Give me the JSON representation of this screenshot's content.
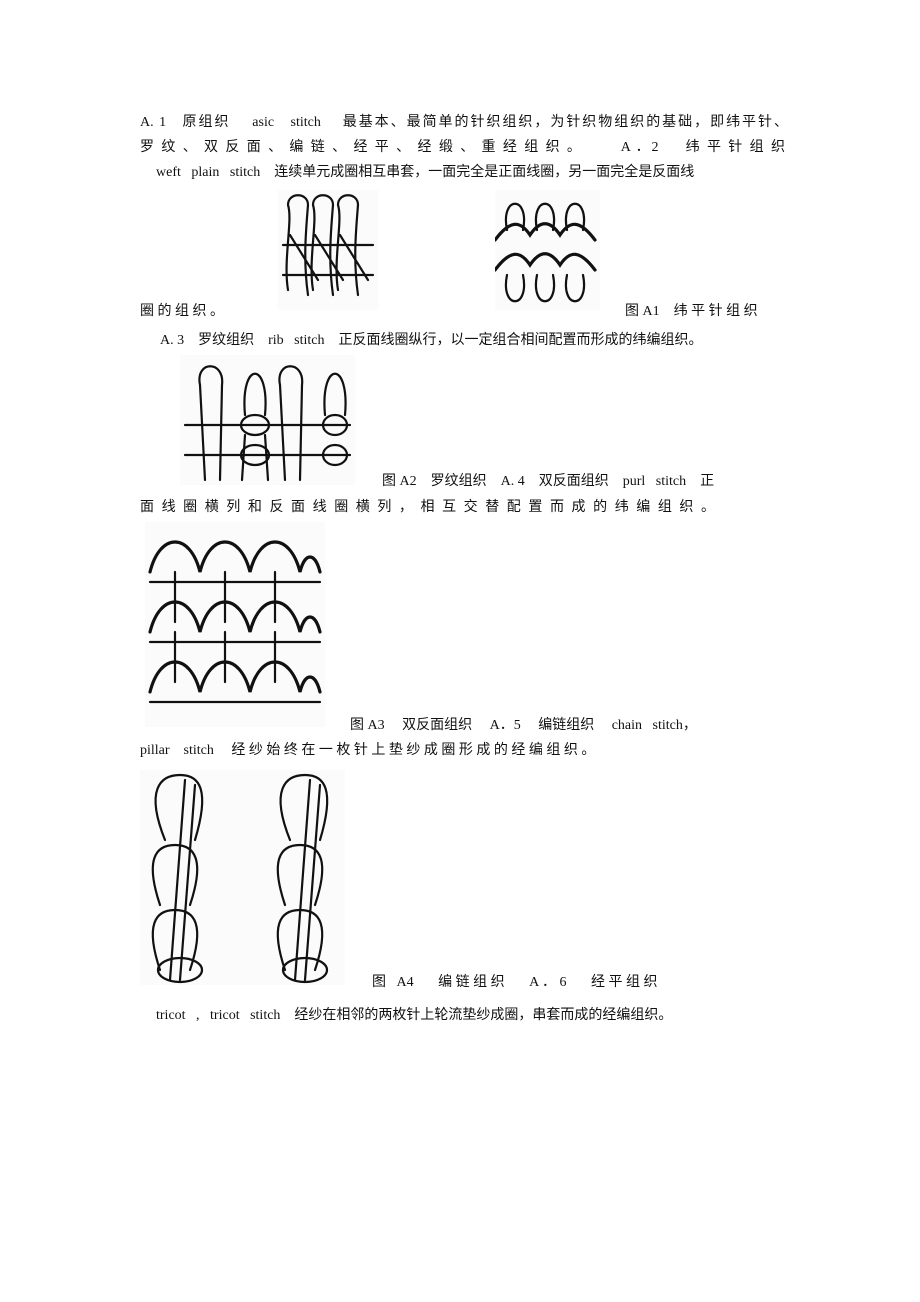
{
  "lines": {
    "l1": "A. 1   原组织    asic   stitch    最基本、最简单的针织组织，为针织物组织的基础，即纬平针、",
    "l2": "罗 纹 、 双 反 面 、 编 链 、 经 平 、 经 缎 、 重 经 组 织 。       A ．2     纬 平 针 组 织",
    "l3": "weft   plain   stitch    连续单元成圈相互串套，一面完全是正面线圈，另一面完全是反面线",
    "l4a": "圈 的 组 织 。",
    "l4b": "图 A1    纬 平 针 组 织",
    "l5": "A. 3    罗纹组织    rib   stitch    正反面线圈纵行，以一定组合相间配置而形成的纬编组织。",
    "l6": "图 A2    罗纹组织    A. 4    双反面组织    purl   stitch    正",
    "l7": "面 线 圈 横 列 和 反 面 线 圈 横 列 ， 相 互 交 替 配 置 而 成 的 纬 编 组 织 。",
    "l8": "图 A3     双反面组织     A．5     编链组织     chain   stitch，",
    "l9": "pillar    stitch     经 纱 始 终 在 一 枚 针 上 垫 纱 成 圈 形 成 的 经 编 组 织 。",
    "l10": "图   A4       编 链 组 织       A ． 6       经 平 组 织",
    "l11": "tricot   ,   tricot   stitch    经纱在相邻的两枚针上轮流垫纱成圈，串套而成的经编组织。"
  },
  "figures": {
    "a1_left": "weft-plain-stitch-face-illustration",
    "a1_right": "weft-plain-stitch-back-illustration",
    "a2": "rib-stitch-illustration",
    "a3": "purl-stitch-illustration",
    "a4": "chain-stitch-illustration"
  }
}
